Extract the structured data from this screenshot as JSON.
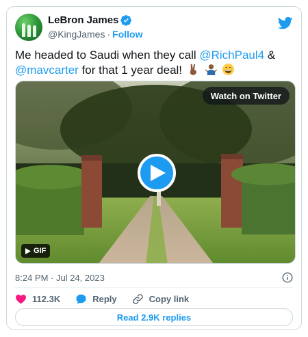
{
  "author": {
    "display_name": "LeBron James",
    "handle": "@KingJames",
    "separator": "·",
    "follow_label": "Follow"
  },
  "tweet": {
    "text_part1": "Me headed to Saudi when they call ",
    "mention1": "@RichPaul4",
    "text_part2": " & ",
    "mention2": "@mavcarter",
    "text_part3": " for that 1 year deal!",
    "emojis": [
      "victory-hand-emoji",
      "person-shrugging-emoji",
      "grinning-face-emoji"
    ]
  },
  "media": {
    "watch_label": "Watch on Twitter",
    "gif_label": "GIF"
  },
  "meta": {
    "timestamp": "8:24 PM · Jul 24, 2023"
  },
  "actions": {
    "likes_count": "112.3K",
    "reply_label": "Reply",
    "copy_link_label": "Copy link"
  },
  "replies_button": {
    "label": "Read 2.9K replies"
  },
  "colors": {
    "accent": "#1d9bf0",
    "like": "#f91880",
    "secondary_text": "#536471"
  }
}
